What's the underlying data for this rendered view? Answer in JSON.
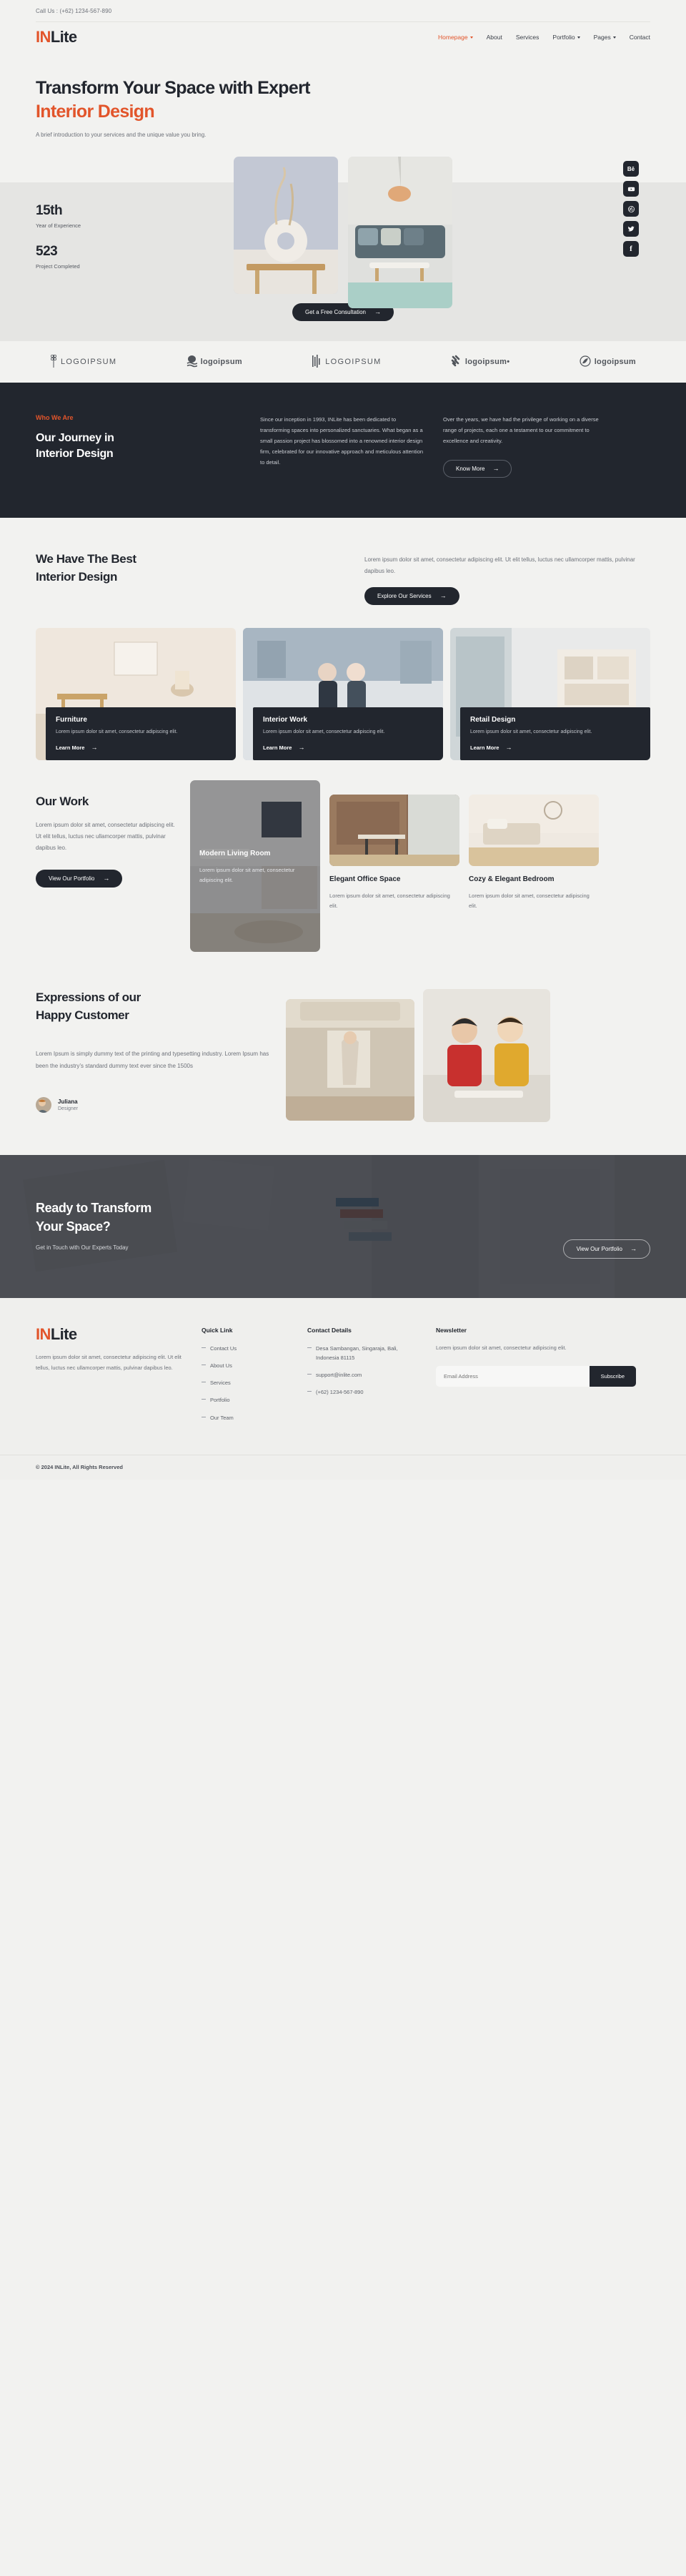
{
  "topbar": {
    "call": "Call Us : (+62) 1234-567-890"
  },
  "brand": {
    "part1": "IN",
    "part2": "Lite"
  },
  "nav": {
    "items": [
      {
        "label": "Homepage",
        "active": true,
        "caret": true
      },
      {
        "label": "About",
        "active": false,
        "caret": false
      },
      {
        "label": "Services",
        "active": false,
        "caret": false
      },
      {
        "label": "Portfolio",
        "active": false,
        "caret": true
      },
      {
        "label": "Pages",
        "active": false,
        "caret": true
      },
      {
        "label": "Contact",
        "active": false,
        "caret": false
      }
    ]
  },
  "hero": {
    "title_line1": "Transform Your Space with Expert",
    "title_line2": "Interior Design",
    "subtitle": "A brief introduction to your services and the unique value you bring.",
    "cta": "Get a Free Consultation",
    "stats": [
      {
        "value": "15th",
        "label": "Year of Experience"
      },
      {
        "value": "523",
        "label": "Project Completed"
      }
    ],
    "socials": [
      {
        "name": "behance-icon",
        "glyph": "Bē"
      },
      {
        "name": "youtube-icon",
        "glyph": "▶"
      },
      {
        "name": "dribbble-icon",
        "glyph": "◉"
      },
      {
        "name": "twitter-icon",
        "glyph": "🐦"
      },
      {
        "name": "facebook-icon",
        "glyph": "f"
      }
    ]
  },
  "logos": [
    {
      "text": "LOGOIPSUM",
      "mark": "wheat-icon",
      "style": "spaced"
    },
    {
      "text": "logoipsum",
      "mark": "egg-wave-icon",
      "style": "normal"
    },
    {
      "text": "LOGOIPSUM",
      "mark": "bars-icon",
      "style": "spaced"
    },
    {
      "text": "logoipsum•",
      "mark": "dots-icon",
      "style": "normal"
    },
    {
      "text": "logoipsum",
      "mark": "circle-swirl-icon",
      "style": "normal"
    }
  ],
  "about": {
    "eyebrow": "Who We Are",
    "heading_line1": "Our Journey in",
    "heading_line2": "Interior Design",
    "col1": "Since our inception in 1993, INLite has been dedicated to transforming spaces into personalized sanctuaries. What began as a small passion project has blossomed into a renowned interior design firm, celebrated for our innovative approach and meticulous attention to detail.",
    "col2": "Over the years, we have had the privilege of working on a diverse range of projects, each one a testament to our commitment to excellence and creativity.",
    "button": "Know More"
  },
  "services": {
    "heading_line1": "We Have The Best",
    "heading_line2": "Interior Design",
    "description": "Lorem ipsum dolor sit amet, consectetur adipiscing elit. Ut elit tellus, luctus nec ullamcorper mattis, pulvinar dapibus leo.",
    "button": "Explore Our Services",
    "cards": [
      {
        "title": "Furniture",
        "text": "Lorem ipsum dolor sit amet, consectetur adipiscing elit.",
        "link": "Learn More"
      },
      {
        "title": "Interior Work",
        "text": "Lorem ipsum dolor sit amet, consectetur adipiscing elit.",
        "link": "Learn More"
      },
      {
        "title": "Retail Design",
        "text": "Lorem ipsum dolor sit amet, consectetur adipiscing elit.",
        "link": "Learn More"
      }
    ]
  },
  "work": {
    "heading": "Our Work",
    "description": "Lorem ipsum dolor sit amet, consectetur adipiscing elit. Ut elit tellus, luctus nec ullamcorper mattis, pulvinar dapibus leo.",
    "button": "View Our Portfolio",
    "projects": [
      {
        "title": "Modern Living Room",
        "text": "Lorem ipsum dolor sit amet, consectetur adipiscing elit."
      },
      {
        "title": "Elegant Office Space",
        "text": "Lorem ipsum dolor sit amet, consectetur adipiscing elit."
      },
      {
        "title": "Cozy & Elegant Bedroom",
        "text": "Lorem ipsum dolor sit amet, consectetur adipiscing elit."
      }
    ]
  },
  "testimonial": {
    "heading_line1": "Expressions of our",
    "heading_line2": "Happy Customer",
    "quote": "Lorem Ipsum is simply dummy text of the printing and typesetting industry. Lorem Ipsum has been the industry’s standard dummy text ever since the 1500s",
    "person_name": "Juliana",
    "person_role": "Designer"
  },
  "cta": {
    "heading_line1": "Ready to Transform",
    "heading_line2": "Your Space?",
    "subtitle": "Get in Touch with Our Experts Today",
    "button": "View Our Portfolio"
  },
  "footer": {
    "about_text": "Lorem ipsum dolor sit amet, consectetur adipiscing elit. Ut elit tellus, luctus nec ullamcorper mattis, pulvinar dapibus leo.",
    "quick_link_title": "Quick Link",
    "quick_links": [
      "Contact Us",
      "About Us",
      "Services",
      "Portfolio",
      "Our Team"
    ],
    "contact_title": "Contact Details",
    "contact_items": [
      "Desa Sambangan, Singaraja, Bali, Indonesia 81115",
      "support@inlite.com",
      "(+62) 1234-567-890"
    ],
    "newsletter_title": "Newsletter",
    "newsletter_text": "Lorem ipsum dolor sit amet, consectetur adipiscing elit.",
    "email_placeholder": "Email Address",
    "email_value": "",
    "subscribe": "Subscribe",
    "copyright": "© 2024 INLite, All Rights Reserved"
  },
  "colors": {
    "accent": "#e2552b",
    "dark": "#22262e",
    "bg": "#f2f2f0",
    "band": "#e5e5e3"
  }
}
